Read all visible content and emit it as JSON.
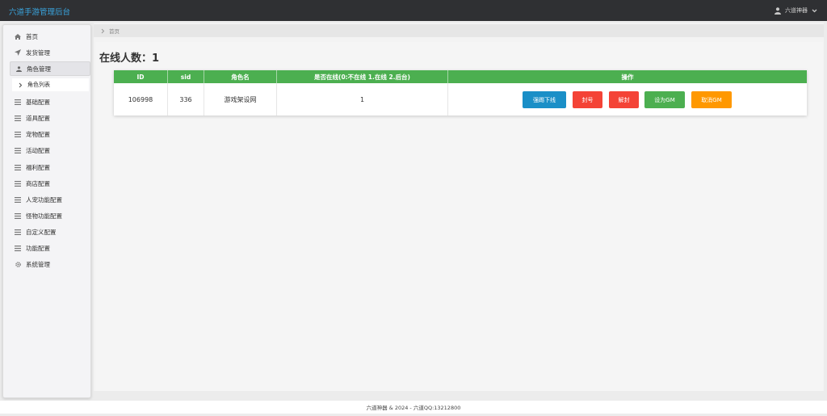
{
  "app": {
    "title": "六道手游管理后台"
  },
  "user": {
    "name": "六道神器",
    "icon": "user-icon"
  },
  "sidebar": {
    "items": [
      {
        "label": "首页",
        "icon": "home-icon"
      },
      {
        "label": "发货管理",
        "icon": "send-icon"
      },
      {
        "label": "角色管理",
        "icon": "user-icon",
        "sub": [
          {
            "label": "角色列表"
          }
        ]
      },
      {
        "label": "基础配置",
        "icon": "list-icon"
      },
      {
        "label": "道具配置",
        "icon": "list-icon"
      },
      {
        "label": "宠物配置",
        "icon": "list-icon"
      },
      {
        "label": "活动配置",
        "icon": "list-icon"
      },
      {
        "label": "福利配置",
        "icon": "list-icon"
      },
      {
        "label": "商店配置",
        "icon": "list-icon"
      },
      {
        "label": "人宠功能配置",
        "icon": "list-icon"
      },
      {
        "label": "怪物功能配置",
        "icon": "list-icon"
      },
      {
        "label": "自定义配置",
        "icon": "list-icon"
      },
      {
        "label": "功能配置",
        "icon": "list-icon"
      },
      {
        "label": "系统管理",
        "icon": "gear-icon"
      }
    ]
  },
  "breadcrumb": {
    "label": "首页"
  },
  "page": {
    "title": "在线人数：1"
  },
  "table": {
    "headers": [
      "ID",
      "sid",
      "角色名",
      "是否在线(0:不在线 1.在线 2.后台)",
      "操作"
    ],
    "rows": [
      {
        "id": "106998",
        "sid": "336",
        "name": "游戏架设网",
        "online": "1"
      }
    ],
    "actions": [
      "强踢下线",
      "封号",
      "解封",
      "设为GM",
      "取消GM"
    ]
  },
  "colors": {
    "header": "#4caf50",
    "kick": "#1a8fc7",
    "ban": "#f44336",
    "unban": "#f44336",
    "setgm": "#4caf50",
    "cancelgm": "#ff9800"
  },
  "footer": {
    "text": "六道神器 & 2024 - 六道QQ:13212800"
  }
}
